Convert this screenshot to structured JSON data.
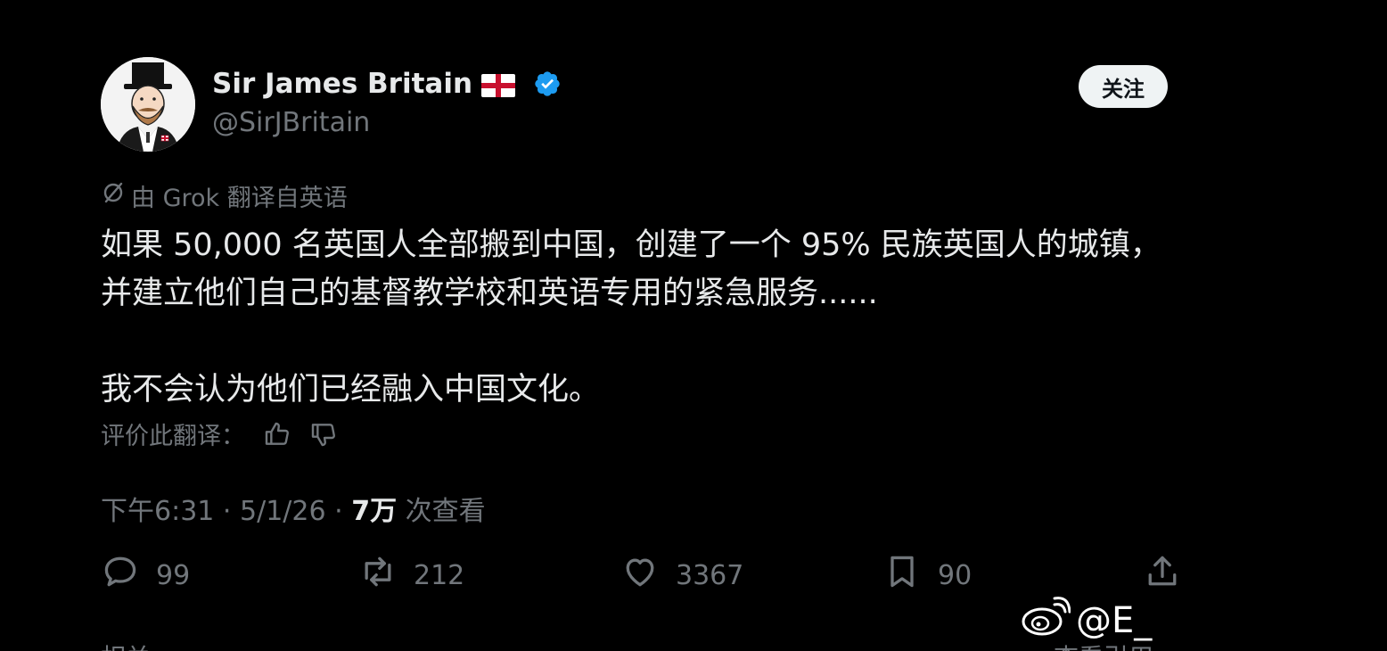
{
  "header": {
    "display_name": "Sir James Britain",
    "handle": "@SirJBritain",
    "follow_label": "关注"
  },
  "translation": {
    "note": "由 Grok 翻译自英语",
    "rate_label": "评价此翻译："
  },
  "tweet": {
    "paragraph_1": "如果 50,000 名英国人全部搬到中国，创建了一个 95% 民族英国人的城镇，并建立他们自己的基督教学校和英语专用的紧急服务......",
    "paragraph_2": "我不会认为他们已经融入中国文化。"
  },
  "meta": {
    "time": "下午6:31",
    "separator": "·",
    "date": "5/1/26",
    "views_count": "7万",
    "views_label": "次查看"
  },
  "actions": {
    "replies": "99",
    "reposts": "212",
    "likes": "3367",
    "bookmarks": "90"
  },
  "watermark": {
    "text": "@E_"
  },
  "cut_off": {
    "left_text": "相关",
    "right_text": "查看引用"
  },
  "colors": {
    "background": "#000000",
    "primary_text": "#e7e9ea",
    "secondary_text": "#71767b",
    "verified_blue": "#1d9bf0",
    "follow_button_bg": "#eff3f4"
  },
  "icons": {
    "verified": "verified-badge-icon",
    "flag": "england-flag-icon",
    "translate": "grok-icon",
    "thumb_up": "thumbs-up-icon",
    "thumb_down": "thumbs-down-icon",
    "reply": "reply-icon",
    "repost": "repost-icon",
    "like": "heart-icon",
    "bookmark": "bookmark-icon",
    "share": "share-icon",
    "weibo": "weibo-icon"
  }
}
